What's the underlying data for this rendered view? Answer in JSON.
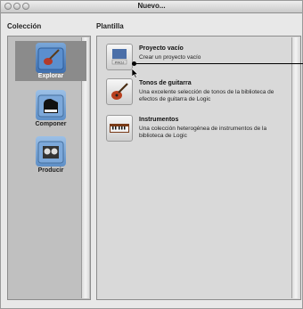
{
  "window": {
    "title": "Nuevo..."
  },
  "headers": {
    "collection": "Colección",
    "template": "Plantilla"
  },
  "collections": [
    {
      "label": "Explorar",
      "icon": "guitar-folder-icon",
      "selected": true
    },
    {
      "label": "Componer",
      "icon": "piano-folder-icon",
      "selected": false
    },
    {
      "label": "Producir",
      "icon": "tape-recorder-folder-icon",
      "selected": false
    }
  ],
  "templates": [
    {
      "name": "Proyecto vacío",
      "description": "Crear un proyecto vacío",
      "icon": "empty-project-icon",
      "icon_text": "PROJ"
    },
    {
      "name": "Tonos de guitarra",
      "description": "Una excelente selección de tonos de la biblioteca de efectos de guitarra de Logic",
      "icon": "guitar-icon"
    },
    {
      "name": "Instrumentos",
      "description": "Una colección heterogénea de instrumentos de la biblioteca de Logic",
      "icon": "keyboard-icon"
    }
  ],
  "colors": {
    "selection": "#8b8b8b",
    "panel": "#d9d9d9"
  }
}
